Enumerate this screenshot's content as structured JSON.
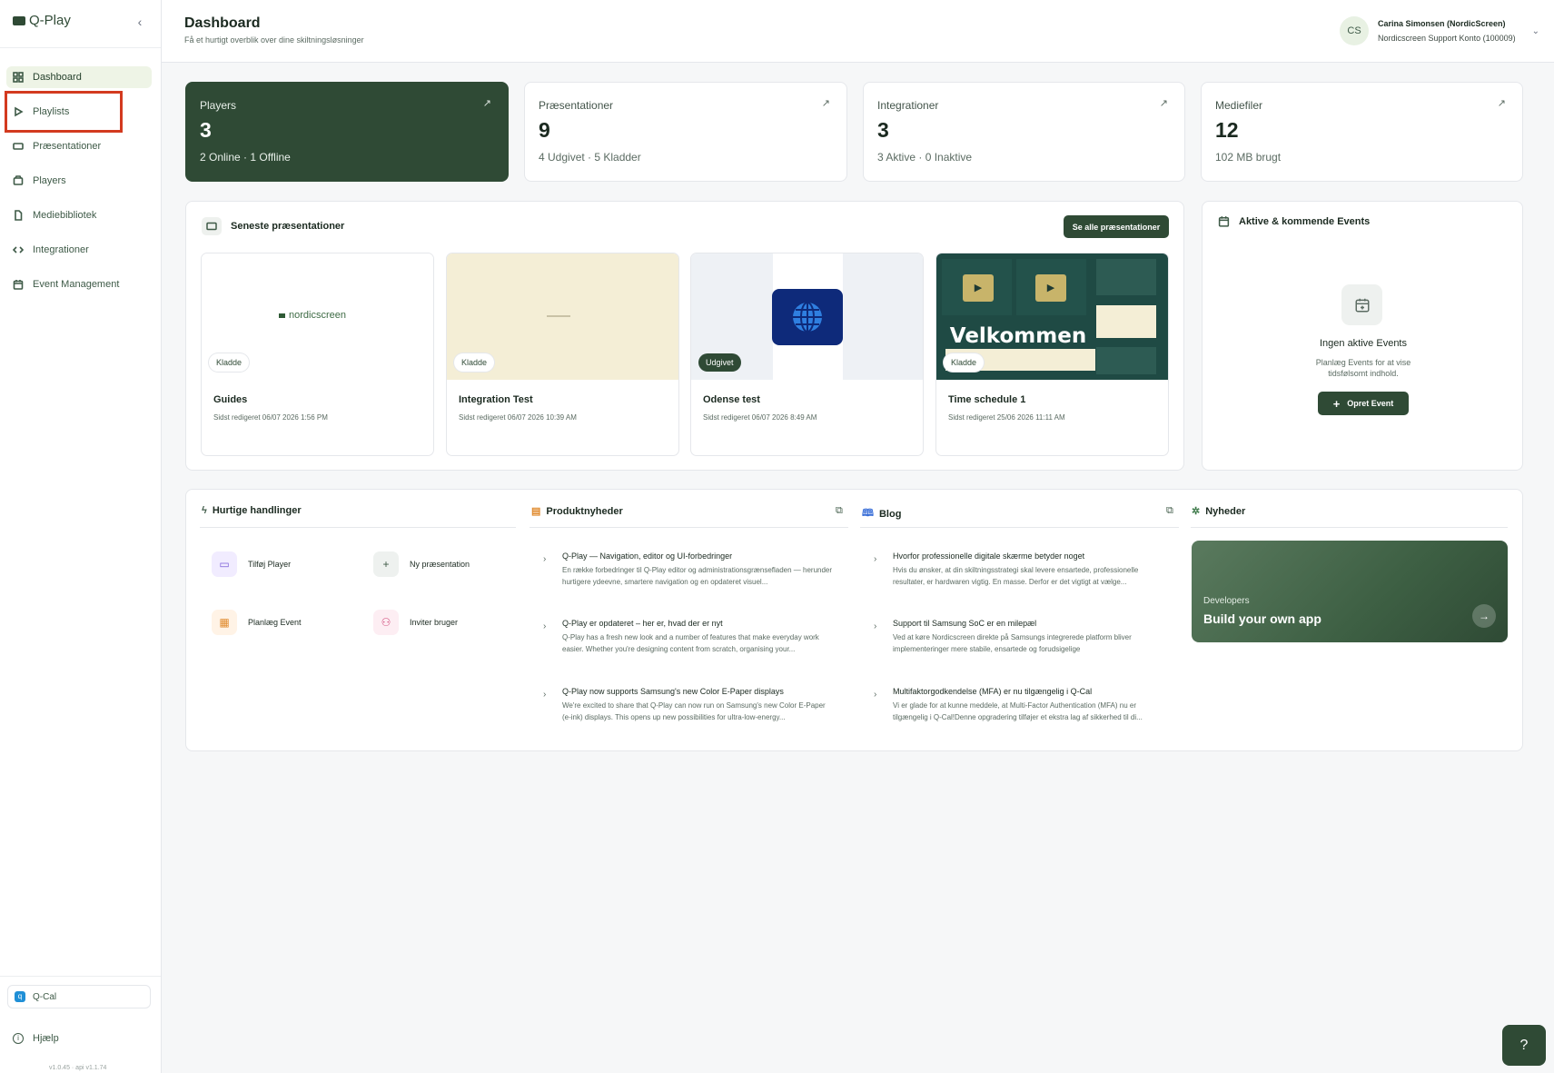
{
  "app": {
    "name": "Q-Play",
    "version": "v1.0.45 · api v1.1.74"
  },
  "sidebar": {
    "items": [
      {
        "label": "Dashboard"
      },
      {
        "label": "Playlists"
      },
      {
        "label": "Præsentationer"
      },
      {
        "label": "Players"
      },
      {
        "label": "Mediebibliotek"
      },
      {
        "label": "Integrationer"
      },
      {
        "label": "Event Management"
      }
    ],
    "qcal": "Q-Cal",
    "help": "Hjælp"
  },
  "header": {
    "title": "Dashboard",
    "subtitle": "Få et hurtigt overblik over dine skiltningsløsninger",
    "user": {
      "initials": "CS",
      "name": "Carina Simonsen (NordicScreen)",
      "account": "Nordicscreen Support Konto (100009)"
    }
  },
  "stats": [
    {
      "label": "Players",
      "value": "3",
      "sub": "2 Online · 1 Offline"
    },
    {
      "label": "Præsentationer",
      "value": "9",
      "sub": "4 Udgivet · 5 Kladder"
    },
    {
      "label": "Integrationer",
      "value": "3",
      "sub": "3 Aktive · 0 Inaktive"
    },
    {
      "label": "Mediefiler",
      "value": "12",
      "sub": "102 MB brugt"
    }
  ],
  "presentations": {
    "title": "Seneste præsentationer",
    "see_all": "Se alle præsentationer",
    "items": [
      {
        "title": "Guides",
        "date": "Sidst redigeret 06/07 2026 1:56 PM",
        "status": "Kladde",
        "thumb_text": "nordicscreen"
      },
      {
        "title": "Integration Test",
        "date": "Sidst redigeret 06/07 2026 10:39 AM",
        "status": "Kladde",
        "thumb_text": ""
      },
      {
        "title": "Odense test",
        "date": "Sidst redigeret 06/07 2026 8:49 AM",
        "status": "Udgivet",
        "thumb_text": ""
      },
      {
        "title": "Time schedule 1",
        "date": "Sidst redigeret 25/06 2026 11:11 AM",
        "status": "Kladde",
        "thumb_text": "Velkommen"
      }
    ]
  },
  "events": {
    "title": "Aktive & kommende Events",
    "empty_title": "Ingen aktive Events",
    "empty_sub": "Planlæg Events for at vise tidsfølsomt indhold.",
    "create": "Opret Event"
  },
  "quick_actions": {
    "title": "Hurtige handlinger",
    "items": [
      {
        "label": "Tilføj Player"
      },
      {
        "label": "Ny præsentation"
      },
      {
        "label": "Planlæg Event"
      },
      {
        "label": "Inviter bruger"
      }
    ]
  },
  "product_news": {
    "title": "Produktnyheder",
    "items": [
      {
        "title": "Q-Play — Navigation, editor og UI-forbedringer",
        "desc": "En række forbedringer til Q-Play editor og administrationsgrænsefladen — herunder hurtigere ydeevne, smartere navigation og en opdateret visuel..."
      },
      {
        "title": "Q-Play er opdateret – her er, hvad der er nyt",
        "desc": "Q-Play has a fresh new look and a number of features that make everyday work easier. Whether you're designing content from scratch, organising your..."
      },
      {
        "title": "Q-Play now supports Samsung's new Color E-Paper displays",
        "desc": "We're excited to share that Q-Play can now run on Samsung's new Color E-Paper (e-ink) displays. This opens up new possibilities for ultra-low-energy..."
      }
    ]
  },
  "blog": {
    "title": "Blog",
    "items": [
      {
        "title": "Hvorfor professionelle digitale skærme betyder noget",
        "desc": "Hvis du ønsker, at din skiltningsstrategi skal levere ensartede, professionelle resultater, er hardwaren vigtig. En masse. Derfor er det vigtigt at vælge..."
      },
      {
        "title": "Support til Samsung SoC er en milepæl",
        "desc": "Ved at køre Nordicscreen direkte på Samsungs integrerede platform bliver implementeringer mere stabile, ensartede og forudsigelige"
      },
      {
        "title": "Multifaktorgodkendelse (MFA) er nu tilgængelig i Q-Cal",
        "desc": "Vi er glade for at kunne meddele, at Multi-Factor Authentication (MFA) nu er tilgængelig i Q-Cal!Denne opgradering tilføjer et ekstra lag af sikkerhed til di..."
      }
    ]
  },
  "nyheder": {
    "title": "Nyheder",
    "card_label": "Developers",
    "card_title": "Build your own app"
  },
  "colors": {
    "accent": "#2f4a35",
    "highlight": "#d33a1f"
  }
}
